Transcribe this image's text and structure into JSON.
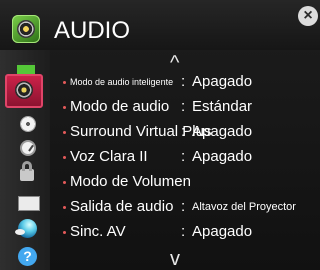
{
  "header": {
    "title": "AUDIO",
    "close_label": "×"
  },
  "sidebar": {
    "items": [
      {
        "icon": "picture-icon"
      },
      {
        "icon": "audio-icon",
        "active": true
      },
      {
        "icon": "disc-icon"
      },
      {
        "icon": "clock-icon"
      },
      {
        "icon": "lock-icon"
      },
      {
        "icon": "option-icon"
      },
      {
        "icon": "network-icon"
      },
      {
        "icon": "help-icon",
        "glyph": "?"
      }
    ]
  },
  "menu": {
    "scroll_up": "^",
    "scroll_down": "v",
    "items": [
      {
        "label": "Modo de audio inteligente",
        "colon": ":",
        "value": "Apagado"
      },
      {
        "label": "Modo de audio",
        "colon": ":",
        "value": "Estándar"
      },
      {
        "label": "Surround Virtual Plus",
        "colon": ":",
        "value": "Apagado"
      },
      {
        "label": "Voz Clara II",
        "colon": ":",
        "value": "Apagado"
      },
      {
        "label": "Modo de Volumen",
        "colon": "",
        "value": ""
      },
      {
        "label": "Salida de audio",
        "colon": ":",
        "value": "Altavoz del Proyector"
      },
      {
        "label": "Sinc. AV",
        "colon": ":",
        "value": "Apagado"
      }
    ]
  },
  "colors": {
    "accent_red": "#cb2249",
    "bullet": "#e45a5a",
    "text": "#ffffff",
    "background": "#151515"
  }
}
